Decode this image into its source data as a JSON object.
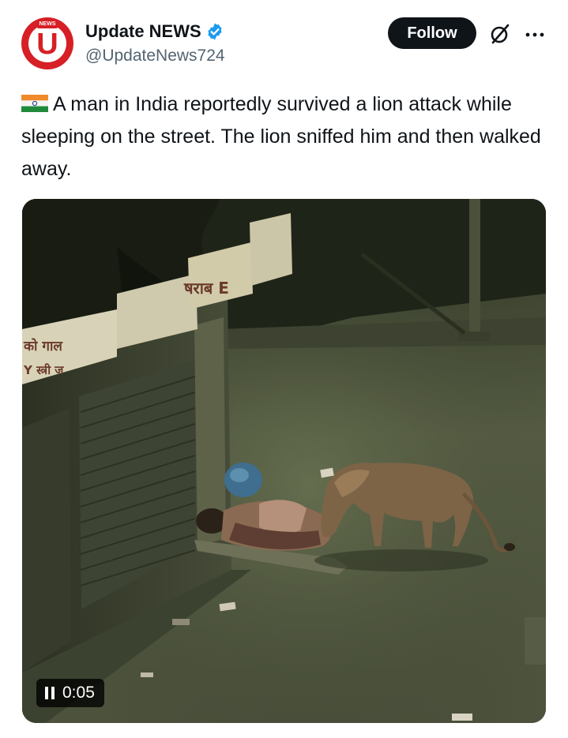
{
  "author": {
    "display_name": "Update NEWS",
    "handle": "@UpdateNews724",
    "avatar_icon": "update-news-logo",
    "avatar_tag": "NEWS",
    "avatar_letter": "U",
    "verified": true,
    "brand_color": "#d71f26"
  },
  "header": {
    "follow_label": "Follow",
    "grok_icon": "grok-icon",
    "more_icon": "more-icon"
  },
  "tweet": {
    "flag_icon": "india-flag-icon",
    "text": "A man in India reportedly survived a lion attack while sleeping on the street. The lion sniffed him and then walked away."
  },
  "media": {
    "type": "video",
    "playback_state": "playing",
    "elapsed_time": "0:05",
    "pause_icon": "pause-icon",
    "sign_texts": {
      "sign_upper": "षराब E",
      "sign_left_1": "को गाल",
      "sign_left_2": "Y स्त्री ज"
    }
  },
  "colors": {
    "text_primary": "#0f1419",
    "text_secondary": "#536471",
    "follow_bg": "#0f1419",
    "verified_blue": "#1d9bf0"
  }
}
